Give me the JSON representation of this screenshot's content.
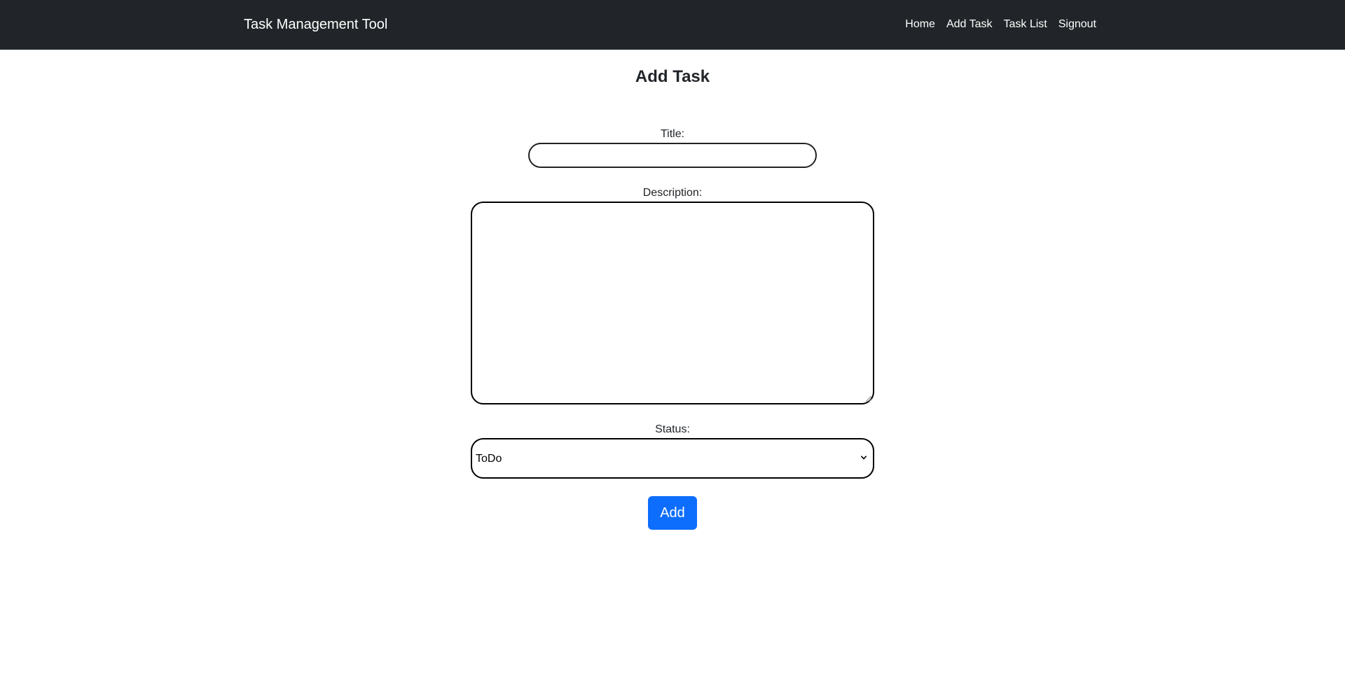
{
  "navbar": {
    "brand": "Task Management Tool",
    "links": [
      {
        "label": "Home"
      },
      {
        "label": "Add Task"
      },
      {
        "label": "Task List"
      },
      {
        "label": "Signout"
      }
    ],
    "background": "#212529"
  },
  "page": {
    "title": "Add Task"
  },
  "form": {
    "title_label": "Title:",
    "title_value": "",
    "description_label": "Description:",
    "description_value": "",
    "status_label": "Status:",
    "status_selected": "ToDo",
    "submit_label": "Add",
    "submit_color": "#0d6efd"
  }
}
